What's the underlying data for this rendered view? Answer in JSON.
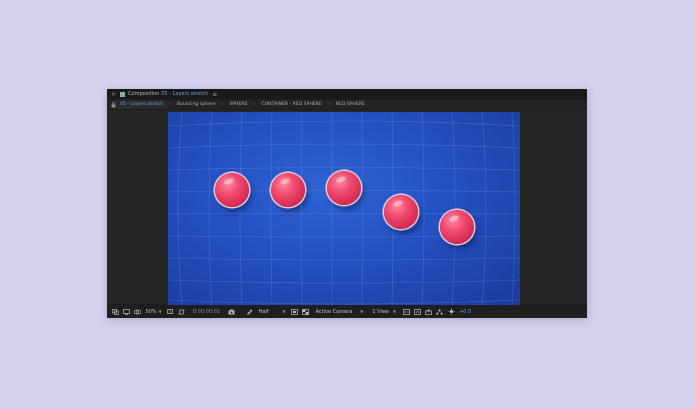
{
  "titlebar": {
    "close": "×",
    "comp_label": "Composition",
    "comp_name": "05 - Layers stretch",
    "menu": "≡"
  },
  "tabs": [
    {
      "label": "05 - Layers stretch",
      "active": true
    },
    {
      "label": "Bouncing sphere",
      "active": false
    },
    {
      "label": "SPHERE",
      "active": false
    },
    {
      "label": "CONTAINER - RED SPHERE",
      "active": false
    },
    {
      "label": "RED SPHERE",
      "active": false
    }
  ],
  "tab_separator": "‹",
  "statusbar": {
    "zoom": "50%",
    "timecode": "0:00:00:01",
    "resolution": "Half",
    "camera": "Active Camera",
    "views": "1 View",
    "exposure": "+0.0"
  },
  "colors": {
    "accent": "#5aa3e8",
    "canvas": "#2450c0",
    "ball": "#f04a6e"
  }
}
